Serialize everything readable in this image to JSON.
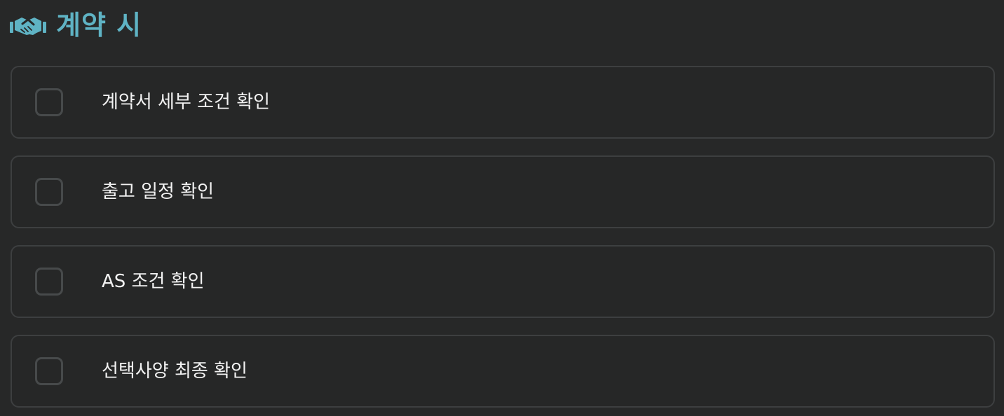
{
  "section": {
    "icon": "handshake-icon",
    "title": "계약 시",
    "accent_color": "#5fb3c4"
  },
  "checklist": {
    "items": [
      {
        "label": "계약서 세부 조건 확인",
        "checked": false
      },
      {
        "label": "출고 일정 확인",
        "checked": false
      },
      {
        "label": "AS 조건 확인",
        "checked": false
      },
      {
        "label": "선택사양 최종 확인",
        "checked": false
      }
    ]
  }
}
